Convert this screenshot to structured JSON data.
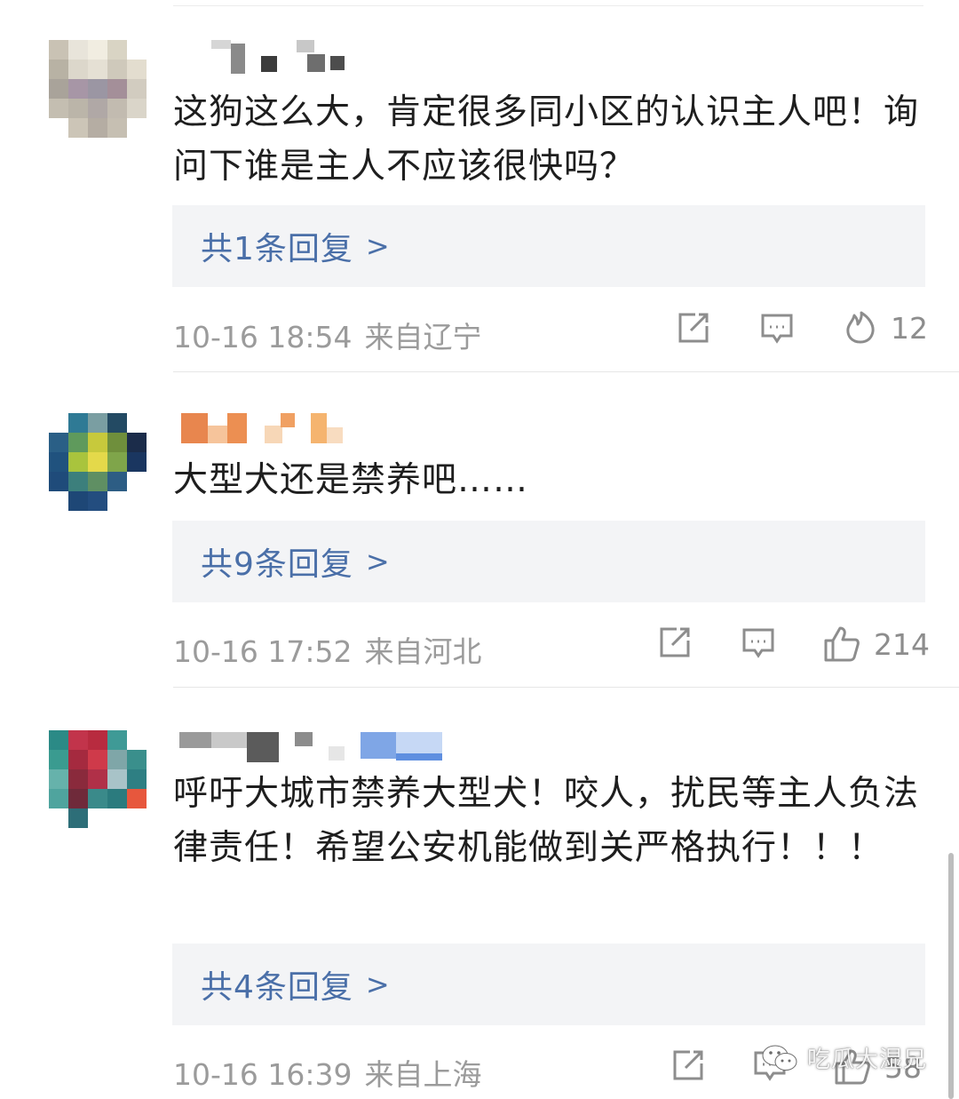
{
  "comments": [
    {
      "text": "这狗这么大，肯定很多同小区的认识主人吧！询问下谁是主人不应该很快吗？",
      "reply_label": "共1条回复",
      "reply_chevron": ">",
      "time": "10-16 18:54",
      "location": "来自辽宁",
      "reaction_icon": "fire-icon",
      "reaction_count": "12"
    },
    {
      "text": "大型犬还是禁养吧……",
      "reply_label": "共9条回复",
      "reply_chevron": ">",
      "time": "10-16 17:52",
      "location": "来自河北",
      "reaction_icon": "thumbs-up-icon",
      "reaction_count": "214"
    },
    {
      "text": "呼吁大城市禁养大型犬！咬人，扰民等主人负法律责任！希望公安机能做到关严格执行！！！",
      "reply_label": "共4条回复",
      "reply_chevron": ">",
      "time": "10-16 16:39",
      "location": "来自上海",
      "reaction_icon": "thumbs-up-icon",
      "reaction_count": "58"
    }
  ],
  "watermark": {
    "label": "吃瓜大湿兄",
    "icon": "wechat-icon"
  },
  "colors": {
    "link": "#4a6fa8",
    "meta": "#9b9b9b",
    "reply_bg": "#f3f4f6",
    "divider": "#e6e6e6"
  }
}
